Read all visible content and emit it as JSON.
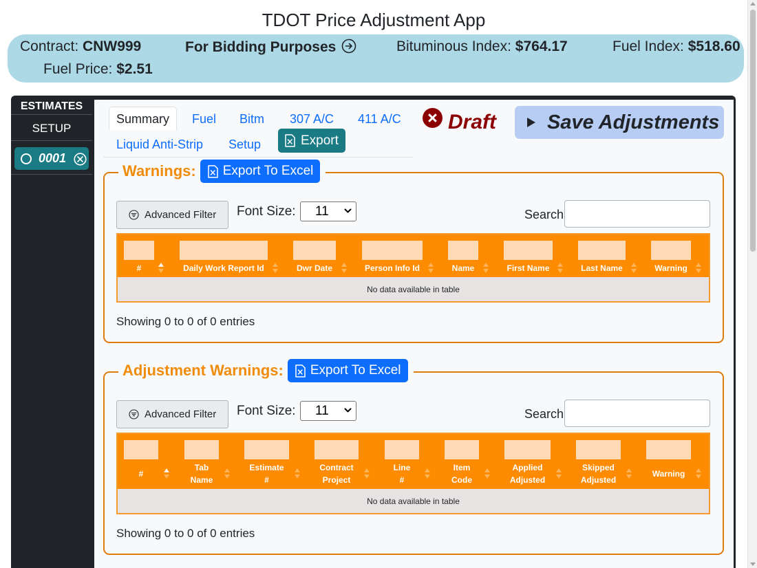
{
  "app_title": "TDOT Price Adjustment App",
  "banner": {
    "contract_label": "Contract:",
    "contract_value": "CNW999",
    "bidding": "For Bidding Purposes",
    "bituminous_label": "Bituminous Index:",
    "bituminous_value": "$764.17",
    "fuel_index_label": "Fuel Index:",
    "fuel_index_value": "$518.60",
    "fuel_price_label": "Fuel Price:",
    "fuel_price_value": "$2.51"
  },
  "sidebar": {
    "heading": "ESTIMATES",
    "setup": "SETUP",
    "estimate": "0001"
  },
  "tabs": [
    "Summary",
    "Fuel",
    "Bitm",
    "307 A/C",
    "411 A/C",
    "Liquid Anti-Strip",
    "Setup"
  ],
  "export_label": "Export",
  "status": "Draft",
  "save_label": "Save Adjustments",
  "warnings": {
    "legend": "Warnings:",
    "export_excel": "Export To Excel",
    "filter": "Advanced Filter",
    "font_size_label": "Font Size:",
    "font_size_value": "11",
    "search_label": "Search:",
    "columns": [
      "#",
      "Daily Work Report Id",
      "Dwr Date",
      "Person Info Id",
      "Name",
      "First Name",
      "Last Name",
      "Warning"
    ],
    "empty": "No data available in table",
    "showing": "Showing 0 to 0 of 0 entries"
  },
  "adjustment_warnings": {
    "legend": "Adjustment Warnings:",
    "export_excel": "Export To Excel",
    "filter": "Advanced Filter",
    "font_size_label": "Font Size:",
    "font_size_value": "11",
    "search_label": "Search:",
    "columns": [
      [
        "#"
      ],
      [
        "Tab",
        "Name"
      ],
      [
        "Estimate",
        "#"
      ],
      [
        "Contract",
        "Project"
      ],
      [
        "Line",
        "#"
      ],
      [
        "Item",
        "Code"
      ],
      [
        "Applied",
        "Adjusted"
      ],
      [
        "Skipped",
        "Adjusted"
      ],
      [
        "Warning"
      ]
    ],
    "empty": "No data available in table",
    "showing": "Showing 0 to 0 of 0 entries"
  },
  "colors": {
    "banner": "#add8e6",
    "accent_orange": "#ff8c00",
    "teal": "#1a7b84",
    "primary": "#0d6efd",
    "draft": "#8b0000"
  }
}
